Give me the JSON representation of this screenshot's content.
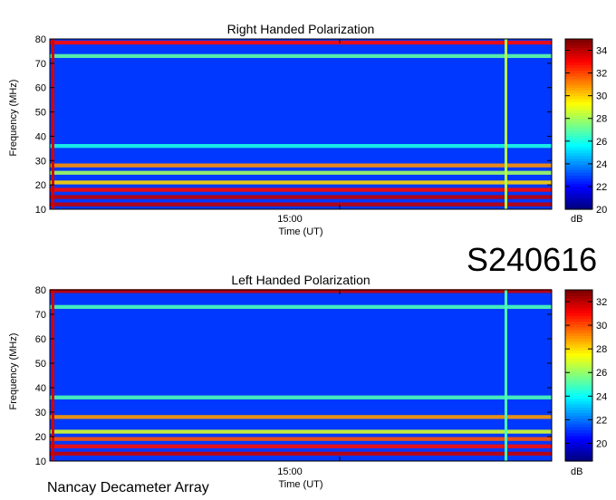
{
  "stamp": "S240616",
  "footer": "Nancay Decameter Array",
  "chart_data": [
    {
      "type": "heatmap",
      "title": "Right Handed Polarization",
      "xlabel": "Time (UT)",
      "ylabel": "Frequency (MHz)",
      "xticks": [
        "15:00"
      ],
      "yticks": [
        10,
        20,
        30,
        40,
        50,
        60,
        70,
        80
      ],
      "ylim": [
        10,
        80
      ],
      "colorbar": {
        "label": "dB",
        "ticks": [
          20,
          22,
          24,
          26,
          28,
          30,
          32,
          34
        ],
        "range": [
          20,
          35
        ]
      },
      "bands": [
        {
          "freq": 78.5,
          "level": 33
        },
        {
          "freq": 73,
          "level": 27
        },
        {
          "freq": 36,
          "level": 26
        },
        {
          "freq": 28,
          "level": 31
        },
        {
          "freq": 25,
          "level": 28
        },
        {
          "freq": 21,
          "level": 30
        },
        {
          "freq": 18,
          "level": 33
        },
        {
          "freq": 15,
          "level": 34
        },
        {
          "freq": 12,
          "level": 34
        }
      ]
    },
    {
      "type": "heatmap",
      "title": "Left Handed Polarization",
      "xlabel": "Time (UT)",
      "ylabel": "Frequency (MHz)",
      "xticks": [
        "15:00"
      ],
      "yticks": [
        10,
        20,
        30,
        40,
        50,
        60,
        70,
        80
      ],
      "ylim": [
        10,
        80
      ],
      "colorbar": {
        "label": "dB",
        "ticks": [
          20,
          22,
          24,
          26,
          28,
          30,
          32
        ],
        "range": [
          18.5,
          33
        ]
      },
      "bands": [
        {
          "freq": 79.5,
          "level": 32
        },
        {
          "freq": 73,
          "level": 25
        },
        {
          "freq": 36,
          "level": 25
        },
        {
          "freq": 28,
          "level": 29
        },
        {
          "freq": 22,
          "level": 27
        },
        {
          "freq": 19,
          "level": 30
        },
        {
          "freq": 16,
          "level": 31
        },
        {
          "freq": 13,
          "level": 32
        }
      ]
    }
  ]
}
